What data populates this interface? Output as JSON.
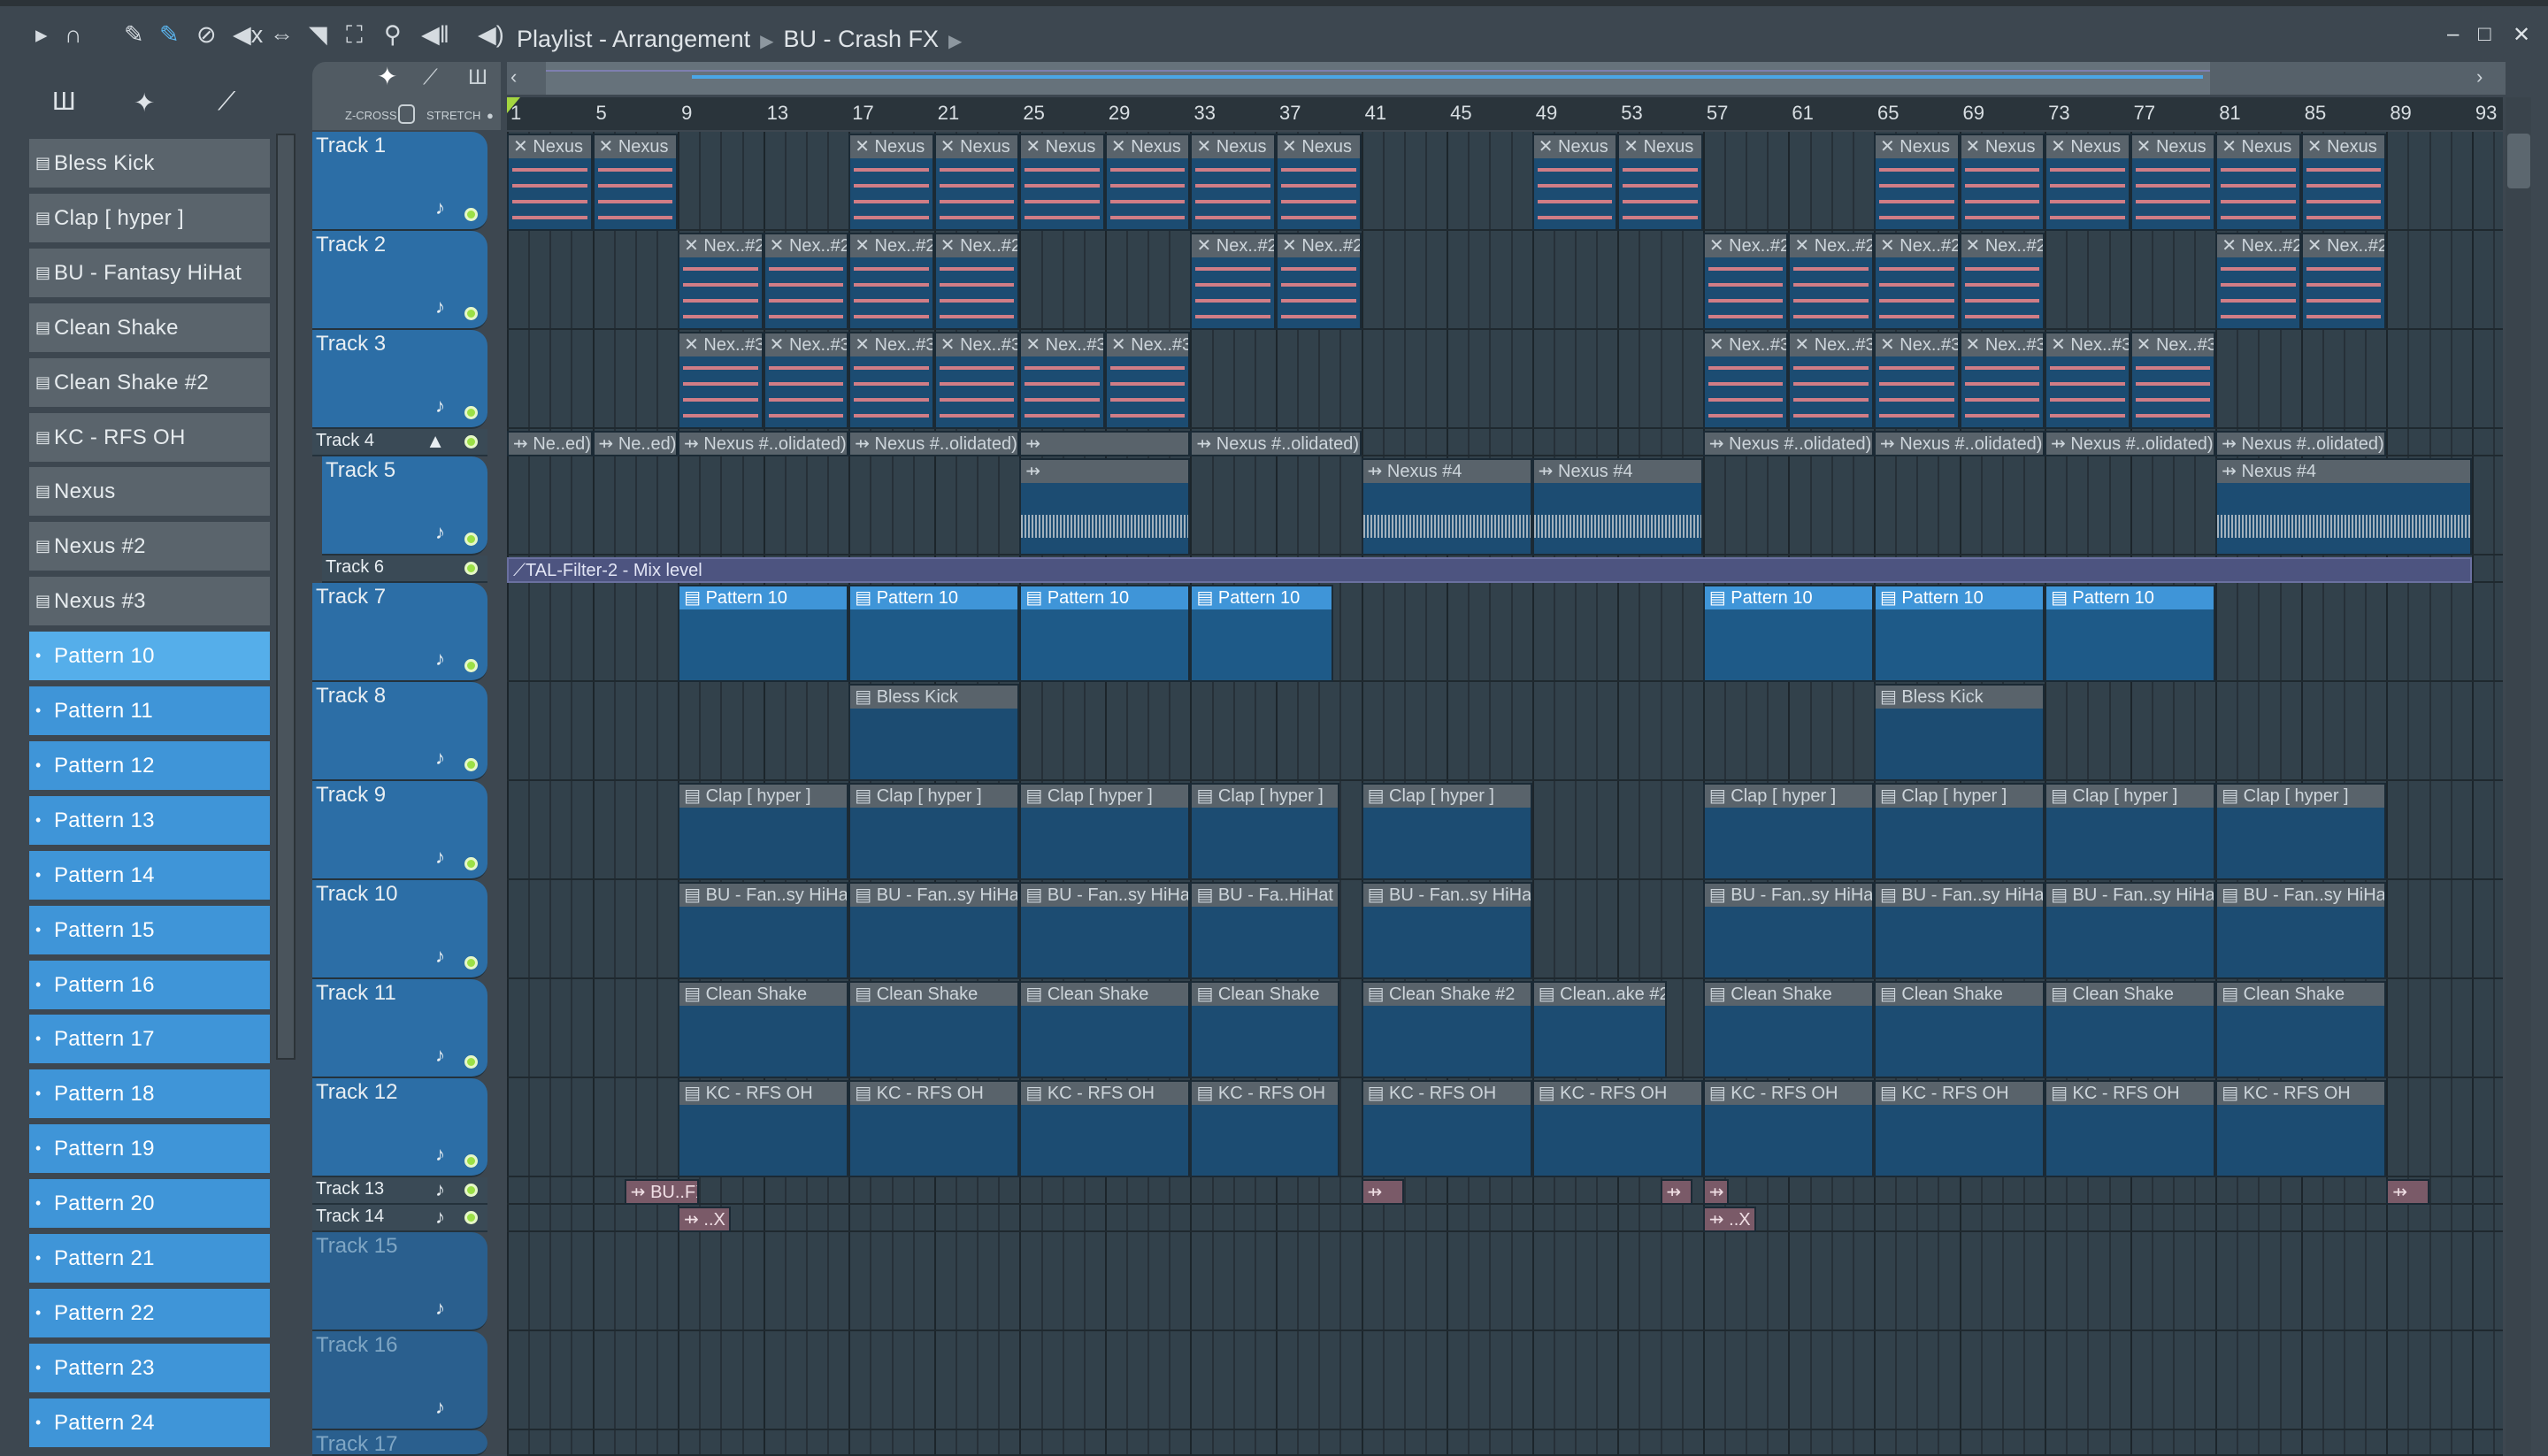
{
  "toolbar": {
    "title": "Playlist - Arrangement",
    "pattern": "BU - Crash FX",
    "icons": [
      "play-arrow",
      "magnet",
      "pencil",
      "paint",
      "delete",
      "mute",
      "slip",
      "slice",
      "select",
      "zoom",
      "playback",
      "speaker"
    ]
  },
  "mode": {
    "zcross": "Z-CROSS",
    "stretch": "STRETCH"
  },
  "channels": [
    {
      "label": "Bless Kick",
      "kind": "grey"
    },
    {
      "label": "Clap [ hyper ]",
      "kind": "grey"
    },
    {
      "label": "BU - Fantasy HiHat",
      "kind": "grey"
    },
    {
      "label": "Clean Shake",
      "kind": "grey"
    },
    {
      "label": "Clean Shake #2",
      "kind": "grey"
    },
    {
      "label": "KC - RFS OH",
      "kind": "grey"
    },
    {
      "label": "Nexus",
      "kind": "grey"
    },
    {
      "label": "Nexus #2",
      "kind": "grey"
    },
    {
      "label": "Nexus #3",
      "kind": "grey"
    },
    {
      "label": "Pattern 10",
      "kind": "sel"
    },
    {
      "label": "Pattern 11",
      "kind": "blue"
    },
    {
      "label": "Pattern 12",
      "kind": "blue"
    },
    {
      "label": "Pattern 13",
      "kind": "blue"
    },
    {
      "label": "Pattern 14",
      "kind": "blue"
    },
    {
      "label": "Pattern 15",
      "kind": "blue"
    },
    {
      "label": "Pattern 16",
      "kind": "blue"
    },
    {
      "label": "Pattern 17",
      "kind": "blue"
    },
    {
      "label": "Pattern 18",
      "kind": "blue"
    },
    {
      "label": "Pattern 19",
      "kind": "blue"
    },
    {
      "label": "Pattern 20",
      "kind": "blue"
    },
    {
      "label": "Pattern 21",
      "kind": "blue"
    },
    {
      "label": "Pattern 22",
      "kind": "blue"
    },
    {
      "label": "Pattern 23",
      "kind": "blue"
    },
    {
      "label": "Pattern 24",
      "kind": "blue"
    }
  ],
  "ruler": [
    1,
    5,
    9,
    13,
    17,
    21,
    25,
    29,
    33,
    37,
    41,
    45,
    49,
    53,
    57,
    61,
    65,
    69,
    73,
    77,
    81,
    85,
    89,
    93
  ],
  "tracks": [
    {
      "name": "Track 1",
      "size": "big"
    },
    {
      "name": "Track 2",
      "size": "big"
    },
    {
      "name": "Track 3",
      "size": "big"
    },
    {
      "name": "Track 4",
      "size": "small"
    },
    {
      "name": "Track 5",
      "size": "big"
    },
    {
      "name": "Track 6",
      "size": "small"
    },
    {
      "name": "Track 7",
      "size": "big"
    },
    {
      "name": "Track 8",
      "size": "big"
    },
    {
      "name": "Track 9",
      "size": "big"
    },
    {
      "name": "Track 10",
      "size": "big"
    },
    {
      "name": "Track 11",
      "size": "big"
    },
    {
      "name": "Track 12",
      "size": "big"
    },
    {
      "name": "Track 13",
      "size": "small"
    },
    {
      "name": "Track 14",
      "size": "small"
    },
    {
      "name": "Track 15",
      "size": "dim"
    },
    {
      "name": "Track 16",
      "size": "dim"
    },
    {
      "name": "Track 17",
      "size": "dim"
    }
  ],
  "clips": [
    {
      "t": 0,
      "s": 1,
      "l": 4,
      "n": "Nexus",
      "k": "notes"
    },
    {
      "t": 0,
      "s": 5,
      "l": 4,
      "n": "Nexus",
      "k": "notes"
    },
    {
      "t": 0,
      "s": 17,
      "l": 4,
      "n": "Nexus",
      "k": "notes"
    },
    {
      "t": 0,
      "s": 21,
      "l": 4,
      "n": "Nexus",
      "k": "notes"
    },
    {
      "t": 0,
      "s": 25,
      "l": 4,
      "n": "Nexus",
      "k": "notes"
    },
    {
      "t": 0,
      "s": 29,
      "l": 4,
      "n": "Nexus",
      "k": "notes"
    },
    {
      "t": 0,
      "s": 33,
      "l": 4,
      "n": "Nexus",
      "k": "notes"
    },
    {
      "t": 0,
      "s": 37,
      "l": 4,
      "n": "Nexus",
      "k": "notes"
    },
    {
      "t": 0,
      "s": 49,
      "l": 4,
      "n": "Nexus",
      "k": "notes"
    },
    {
      "t": 0,
      "s": 53,
      "l": 4,
      "n": "Nexus",
      "k": "notes"
    },
    {
      "t": 0,
      "s": 65,
      "l": 4,
      "n": "Nexus",
      "k": "notes"
    },
    {
      "t": 0,
      "s": 69,
      "l": 4,
      "n": "Nexus",
      "k": "notes"
    },
    {
      "t": 0,
      "s": 73,
      "l": 4,
      "n": "Nexus",
      "k": "notes"
    },
    {
      "t": 0,
      "s": 77,
      "l": 4,
      "n": "Nexus",
      "k": "notes"
    },
    {
      "t": 0,
      "s": 81,
      "l": 4,
      "n": "Nexus",
      "k": "notes"
    },
    {
      "t": 0,
      "s": 85,
      "l": 4,
      "n": "Nexus",
      "k": "notes"
    },
    {
      "t": 1,
      "s": 9,
      "l": 4,
      "n": "Nex..#2",
      "k": "notes"
    },
    {
      "t": 1,
      "s": 13,
      "l": 4,
      "n": "Nex..#2",
      "k": "notes"
    },
    {
      "t": 1,
      "s": 17,
      "l": 4,
      "n": "Nex..#2",
      "k": "notes"
    },
    {
      "t": 1,
      "s": 21,
      "l": 4,
      "n": "Nex..#2",
      "k": "notes"
    },
    {
      "t": 1,
      "s": 33,
      "l": 4,
      "n": "Nex..#2",
      "k": "notes"
    },
    {
      "t": 1,
      "s": 37,
      "l": 4,
      "n": "Nex..#2",
      "k": "notes"
    },
    {
      "t": 1,
      "s": 57,
      "l": 4,
      "n": "Nex..#2",
      "k": "notes"
    },
    {
      "t": 1,
      "s": 61,
      "l": 4,
      "n": "Nex..#2",
      "k": "notes"
    },
    {
      "t": 1,
      "s": 65,
      "l": 4,
      "n": "Nex..#2",
      "k": "notes"
    },
    {
      "t": 1,
      "s": 69,
      "l": 4,
      "n": "Nex..#2",
      "k": "notes"
    },
    {
      "t": 1,
      "s": 81,
      "l": 4,
      "n": "Nex..#2",
      "k": "notes"
    },
    {
      "t": 1,
      "s": 85,
      "l": 4,
      "n": "Nex..#2",
      "k": "notes"
    },
    {
      "t": 2,
      "s": 9,
      "l": 4,
      "n": "Nex..#3",
      "k": "notes"
    },
    {
      "t": 2,
      "s": 13,
      "l": 4,
      "n": "Nex..#3",
      "k": "notes"
    },
    {
      "t": 2,
      "s": 17,
      "l": 4,
      "n": "Nex..#3",
      "k": "notes"
    },
    {
      "t": 2,
      "s": 21,
      "l": 4,
      "n": "Nex..#3",
      "k": "notes"
    },
    {
      "t": 2,
      "s": 25,
      "l": 4,
      "n": "Nex..#3",
      "k": "notes"
    },
    {
      "t": 2,
      "s": 29,
      "l": 4,
      "n": "Nex..#3",
      "k": "notes"
    },
    {
      "t": 2,
      "s": 57,
      "l": 4,
      "n": "Nex..#3",
      "k": "notes"
    },
    {
      "t": 2,
      "s": 61,
      "l": 4,
      "n": "Nex..#3",
      "k": "notes"
    },
    {
      "t": 2,
      "s": 65,
      "l": 4,
      "n": "Nex..#3",
      "k": "notes"
    },
    {
      "t": 2,
      "s": 69,
      "l": 4,
      "n": "Nex..#3",
      "k": "notes"
    },
    {
      "t": 2,
      "s": 73,
      "l": 4,
      "n": "Nex..#3",
      "k": "notes"
    },
    {
      "t": 2,
      "s": 77,
      "l": 4,
      "n": "Nex..#3",
      "k": "notes"
    },
    {
      "t": 3,
      "s": 1,
      "l": 4,
      "n": "Ne..ed)",
      "k": "audio"
    },
    {
      "t": 3,
      "s": 5,
      "l": 4,
      "n": "Ne..ed)",
      "k": "audio"
    },
    {
      "t": 3,
      "s": 9,
      "l": 8,
      "n": "Nexus #..olidated)",
      "k": "audio"
    },
    {
      "t": 3,
      "s": 17,
      "l": 8,
      "n": "Nexus #..olidated)",
      "k": "audio"
    },
    {
      "t": 3,
      "s": 25,
      "l": 8,
      "n": "",
      "k": "audio"
    },
    {
      "t": 3,
      "s": 33,
      "l": 8,
      "n": "Nexus #..olidated)",
      "k": "audio"
    },
    {
      "t": 3,
      "s": 57,
      "l": 8,
      "n": "Nexus #..olidated)",
      "k": "audio"
    },
    {
      "t": 3,
      "s": 65,
      "l": 8,
      "n": "Nexus #..olidated)",
      "k": "audio"
    },
    {
      "t": 3,
      "s": 73,
      "l": 8,
      "n": "Nexus #..olidated)",
      "k": "audio"
    },
    {
      "t": 3,
      "s": 81,
      "l": 8,
      "n": "Nexus #..olidated)",
      "k": "audio"
    },
    {
      "t": 4,
      "s": 25,
      "l": 8,
      "n": "",
      "k": "wave"
    },
    {
      "t": 4,
      "s": 41,
      "l": 8,
      "n": "Nexus #4",
      "k": "wave"
    },
    {
      "t": 4,
      "s": 49,
      "l": 8,
      "n": "Nexus #4",
      "k": "wave"
    },
    {
      "t": 4,
      "s": 81,
      "l": 12,
      "n": "Nexus #4",
      "k": "wave"
    },
    {
      "t": 5,
      "s": 1,
      "l": 92,
      "n": "TAL-Filter-2 - Mix level",
      "k": "auto"
    },
    {
      "t": 6,
      "s": 9,
      "l": 8,
      "n": "Pattern 10",
      "k": "pat"
    },
    {
      "t": 6,
      "s": 17,
      "l": 8,
      "n": "Pattern 10",
      "k": "pat"
    },
    {
      "t": 6,
      "s": 25,
      "l": 8,
      "n": "Pattern 10",
      "k": "pat"
    },
    {
      "t": 6,
      "s": 33,
      "l": 6.7,
      "n": "Pattern 10",
      "k": "pat"
    },
    {
      "t": 6,
      "s": 57,
      "l": 8,
      "n": "Pattern 10",
      "k": "pat"
    },
    {
      "t": 6,
      "s": 65,
      "l": 8,
      "n": "Pattern 10",
      "k": "pat"
    },
    {
      "t": 6,
      "s": 73,
      "l": 8,
      "n": "Pattern 10",
      "k": "pat"
    },
    {
      "t": 7,
      "s": 17,
      "l": 8,
      "n": "Bless Kick",
      "k": "plain"
    },
    {
      "t": 7,
      "s": 65,
      "l": 8,
      "n": "Bless Kick",
      "k": "plain"
    },
    {
      "t": 8,
      "s": 9,
      "l": 8,
      "n": "Clap [ hyper ]",
      "k": "plain"
    },
    {
      "t": 8,
      "s": 17,
      "l": 8,
      "n": "Clap [ hyper ]",
      "k": "plain"
    },
    {
      "t": 8,
      "s": 25,
      "l": 8,
      "n": "Clap [ hyper ]",
      "k": "plain"
    },
    {
      "t": 8,
      "s": 33,
      "l": 7,
      "n": "Clap [ hyper ]",
      "k": "plain"
    },
    {
      "t": 8,
      "s": 41,
      "l": 8,
      "n": "Clap [ hyper ]",
      "k": "plain"
    },
    {
      "t": 8,
      "s": 57,
      "l": 8,
      "n": "Clap [ hyper ]",
      "k": "plain"
    },
    {
      "t": 8,
      "s": 65,
      "l": 8,
      "n": "Clap [ hyper ]",
      "k": "plain"
    },
    {
      "t": 8,
      "s": 73,
      "l": 8,
      "n": "Clap [ hyper ]",
      "k": "plain"
    },
    {
      "t": 8,
      "s": 81,
      "l": 8,
      "n": "Clap [ hyper ]",
      "k": "plain"
    },
    {
      "t": 9,
      "s": 9,
      "l": 8,
      "n": "BU - Fan..sy HiHat",
      "k": "plain"
    },
    {
      "t": 9,
      "s": 17,
      "l": 8,
      "n": "BU - Fan..sy HiHat",
      "k": "plain"
    },
    {
      "t": 9,
      "s": 25,
      "l": 8,
      "n": "BU - Fan..sy HiHat",
      "k": "plain"
    },
    {
      "t": 9,
      "s": 33,
      "l": 7,
      "n": "BU - Fa..HiHat",
      "k": "plain"
    },
    {
      "t": 9,
      "s": 41,
      "l": 8,
      "n": "BU - Fan..sy HiHat",
      "k": "plain"
    },
    {
      "t": 9,
      "s": 57,
      "l": 8,
      "n": "BU - Fan..sy HiHat",
      "k": "plain"
    },
    {
      "t": 9,
      "s": 65,
      "l": 8,
      "n": "BU - Fan..sy HiHat",
      "k": "plain"
    },
    {
      "t": 9,
      "s": 73,
      "l": 8,
      "n": "BU - Fan..sy HiHat",
      "k": "plain"
    },
    {
      "t": 9,
      "s": 81,
      "l": 8,
      "n": "BU - Fan..sy HiHat",
      "k": "plain"
    },
    {
      "t": 10,
      "s": 9,
      "l": 8,
      "n": "Clean Shake",
      "k": "plain"
    },
    {
      "t": 10,
      "s": 17,
      "l": 8,
      "n": "Clean Shake",
      "k": "plain"
    },
    {
      "t": 10,
      "s": 25,
      "l": 8,
      "n": "Clean Shake",
      "k": "plain"
    },
    {
      "t": 10,
      "s": 33,
      "l": 7,
      "n": "Clean Shake",
      "k": "plain"
    },
    {
      "t": 10,
      "s": 41,
      "l": 8,
      "n": "Clean Shake #2",
      "k": "plain"
    },
    {
      "t": 10,
      "s": 49,
      "l": 6.3,
      "n": "Clean..ake #2",
      "k": "plain"
    },
    {
      "t": 10,
      "s": 57,
      "l": 8,
      "n": "Clean Shake",
      "k": "plain"
    },
    {
      "t": 10,
      "s": 65,
      "l": 8,
      "n": "Clean Shake",
      "k": "plain"
    },
    {
      "t": 10,
      "s": 73,
      "l": 8,
      "n": "Clean Shake",
      "k": "plain"
    },
    {
      "t": 10,
      "s": 81,
      "l": 8,
      "n": "Clean Shake",
      "k": "plain"
    },
    {
      "t": 11,
      "s": 9,
      "l": 8,
      "n": "KC - RFS OH",
      "k": "plain"
    },
    {
      "t": 11,
      "s": 17,
      "l": 8,
      "n": "KC - RFS OH",
      "k": "plain"
    },
    {
      "t": 11,
      "s": 25,
      "l": 8,
      "n": "KC - RFS OH",
      "k": "plain"
    },
    {
      "t": 11,
      "s": 33,
      "l": 7,
      "n": "KC - RFS OH",
      "k": "plain"
    },
    {
      "t": 11,
      "s": 41,
      "l": 8,
      "n": "KC - RFS OH",
      "k": "plain"
    },
    {
      "t": 11,
      "s": 49,
      "l": 8,
      "n": "KC - RFS OH",
      "k": "plain"
    },
    {
      "t": 11,
      "s": 57,
      "l": 8,
      "n": "KC - RFS OH",
      "k": "plain"
    },
    {
      "t": 11,
      "s": 65,
      "l": 8,
      "n": "KC - RFS OH",
      "k": "plain"
    },
    {
      "t": 11,
      "s": 73,
      "l": 8,
      "n": "KC - RFS OH",
      "k": "plain"
    },
    {
      "t": 11,
      "s": 81,
      "l": 8,
      "n": "KC - RFS OH",
      "k": "plain"
    },
    {
      "t": 12,
      "s": 6.5,
      "l": 3.5,
      "n": "BU..FX",
      "k": "mini"
    },
    {
      "t": 12,
      "s": 41,
      "l": 2,
      "n": "",
      "k": "mini"
    },
    {
      "t": 12,
      "s": 55,
      "l": 1.5,
      "n": "",
      "k": "mini"
    },
    {
      "t": 12,
      "s": 57,
      "l": 1.2,
      "n": "",
      "k": "mini"
    },
    {
      "t": 12,
      "s": 89,
      "l": 2,
      "n": "",
      "k": "mini"
    },
    {
      "t": 13,
      "s": 9,
      "l": 2.5,
      "n": "..X",
      "k": "mini"
    },
    {
      "t": 13,
      "s": 57,
      "l": 2.5,
      "n": "..X",
      "k": "mini"
    }
  ]
}
